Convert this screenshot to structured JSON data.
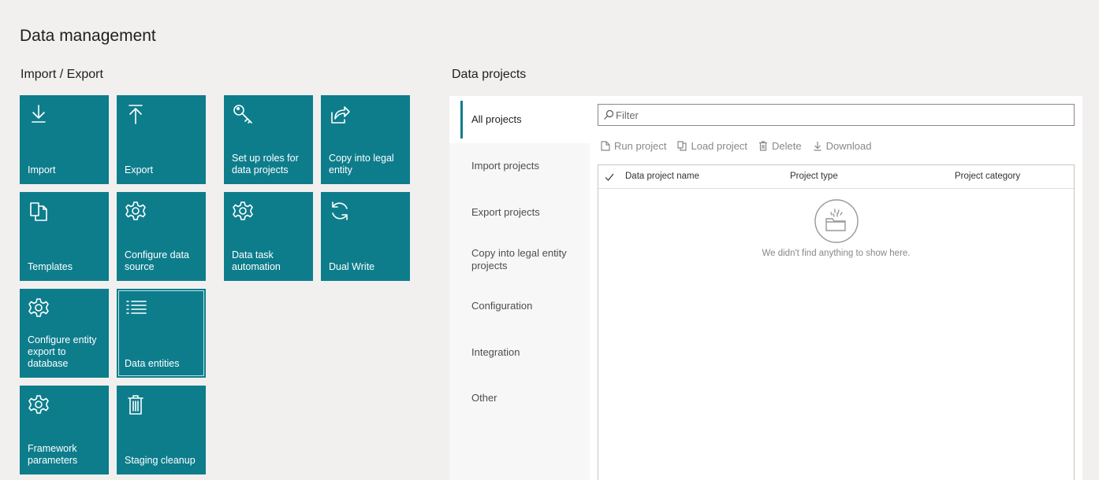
{
  "page": {
    "title": "Data management"
  },
  "import_export": {
    "title": "Import / Export",
    "tiles": [
      {
        "label": "Import",
        "icon": "download-arrow-icon"
      },
      {
        "label": "Export",
        "icon": "upload-arrow-icon"
      },
      {
        "label": "Set up roles for data projects",
        "icon": "key-icon"
      },
      {
        "label": "Copy into legal entity",
        "icon": "share-icon"
      },
      {
        "label": "Templates",
        "icon": "copy-documents-icon"
      },
      {
        "label": "Configure data source",
        "icon": "gear-icon"
      },
      {
        "label": "Data task automation",
        "icon": "gear-icon"
      },
      {
        "label": "Dual Write",
        "icon": "sync-icon"
      },
      {
        "label": "Configure entity export to database",
        "icon": "gear-icon"
      },
      {
        "label": "Data entities",
        "icon": "bulleted-list-icon"
      },
      {
        "label": "Framework parameters",
        "icon": "gear-icon"
      },
      {
        "label": "Staging cleanup",
        "icon": "trash-icon"
      }
    ]
  },
  "data_projects": {
    "title": "Data projects",
    "nav": [
      "All projects",
      "Import projects",
      "Export projects",
      "Copy into legal entity projects",
      "Configuration",
      "Integration",
      "Other"
    ],
    "filter_placeholder": "Filter",
    "toolbar": {
      "run": "Run project",
      "load": "Load project",
      "delete": "Delete",
      "download": "Download"
    },
    "columns": [
      "Data project name",
      "Project type",
      "Project category"
    ],
    "empty_text": "We didn't find anything to show here."
  },
  "colors": {
    "tile": "#0d7d8c",
    "background": "#f1f0ef",
    "accent": "#0d7d8c"
  }
}
